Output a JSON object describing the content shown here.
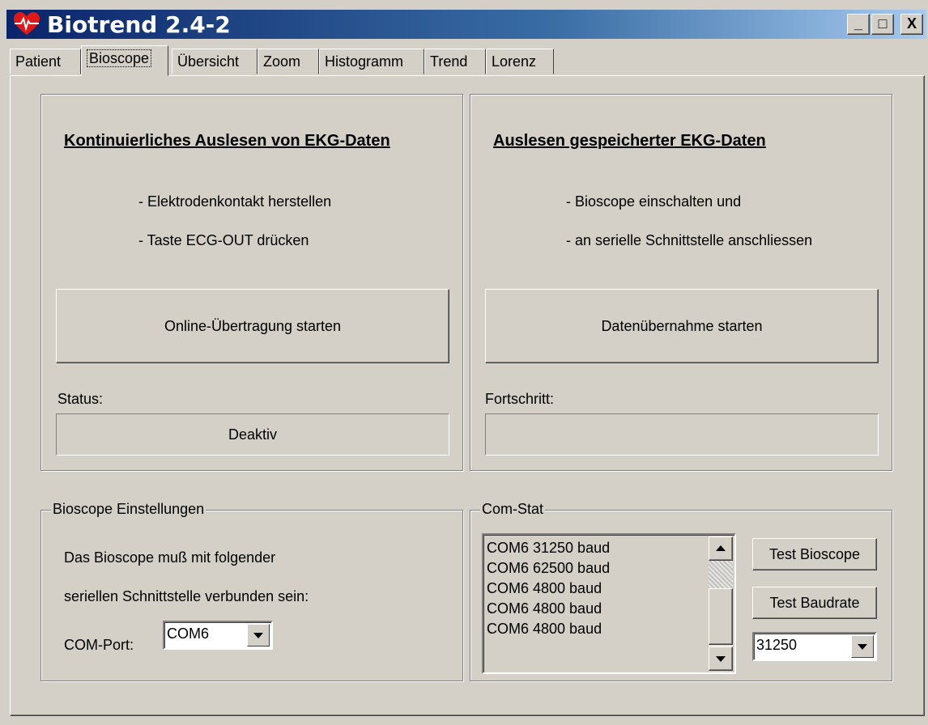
{
  "window": {
    "title": "Biotrend 2.4-2",
    "minimize": "_",
    "maximize": "□",
    "close": "X"
  },
  "tabs": [
    {
      "label": "Patient"
    },
    {
      "label": "Bioscope",
      "active": true
    },
    {
      "label": "Übersicht"
    },
    {
      "label": "Zoom"
    },
    {
      "label": "Histogramm"
    },
    {
      "label": "Trend"
    },
    {
      "label": "Lorenz"
    }
  ],
  "online": {
    "heading": "Kontinuierliches Auslesen von EKG-Daten",
    "step1": "- Elektrodenkontakt herstellen",
    "step2": "- Taste ECG-OUT drücken",
    "button": "Online-Übertragung starten",
    "status_label": "Status:",
    "status_value": "Deaktiv"
  },
  "stored": {
    "heading": "Auslesen gespeicherter EKG-Daten",
    "step1": "- Bioscope einschalten und",
    "step2": "- an serielle Schnittstelle anschliessen",
    "button": "Datenübernahme starten",
    "progress_label": "Fortschritt:",
    "progress_value": ""
  },
  "settings": {
    "legend": "Bioscope Einstellungen",
    "line1": "Das Bioscope muß mit folgender",
    "line2": "seriellen Schnittstelle verbunden sein:",
    "port_label": "COM-Port:",
    "port_value": "COM6"
  },
  "comstat": {
    "legend": "Com-Stat",
    "log": [
      "COM6 31250 baud",
      "COM6 62500 baud",
      "COM6 4800 baud",
      "COM6 4800 baud",
      "COM6 4800 baud"
    ],
    "test_bioscope": "Test Bioscope",
    "test_baudrate": "Test Baudrate",
    "baud_value": "31250"
  },
  "colors": {
    "face": "#d4d0c8",
    "title_start": "#0a246a",
    "title_end": "#a6caf0",
    "icon_red": "#e01818"
  }
}
